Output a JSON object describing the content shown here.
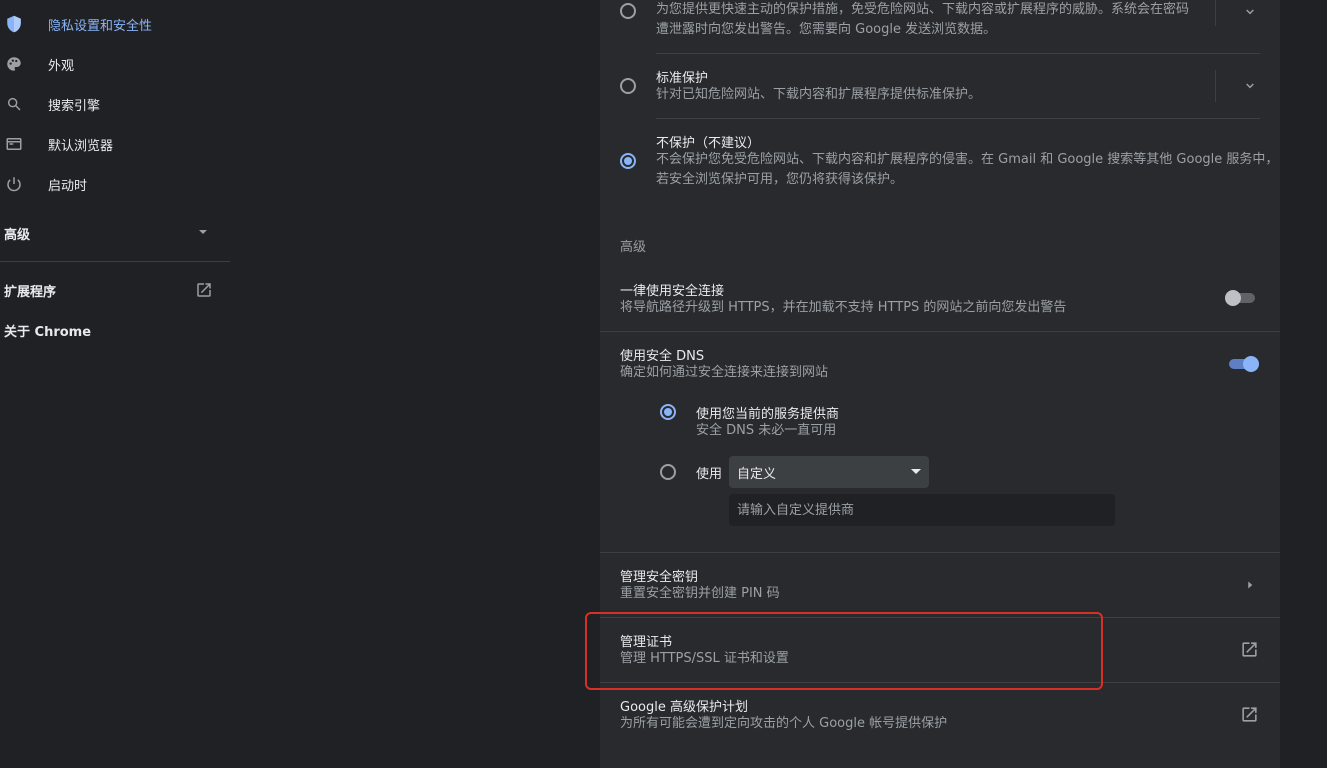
{
  "sidebar": {
    "items": [
      {
        "label": "隐私设置和安全性",
        "icon": "shield-icon",
        "active": true
      },
      {
        "label": "外观",
        "icon": "palette-icon"
      },
      {
        "label": "搜索引擎",
        "icon": "search-icon"
      },
      {
        "label": "默认浏览器",
        "icon": "browser-window-icon"
      },
      {
        "label": "启动时",
        "icon": "power-icon"
      }
    ],
    "advanced_label": "高级",
    "extensions_label": "扩展程序",
    "about_label": "关于 Chrome"
  },
  "safe_browsing": {
    "enhanced_desc_line1": "为您提供更快速主动的保护措施，免受危险网站、下载内容或扩展程序的威胁。系统会在密码",
    "enhanced_desc_line2": "遭泄露时向您发出警告。您需要向 Google 发送浏览数据。",
    "standard_title": "标准保护",
    "standard_desc": "针对已知危险网站、下载内容和扩展程序提供标准保护。",
    "none_title": "不保护（不建议）",
    "none_desc_line1": "不会保护您免受危险网站、下载内容和扩展程序的侵害。在 Gmail 和 Google 搜索等其他 Google 服务中，",
    "none_desc_line2": "若安全浏览保护可用，您仍将获得该保护。",
    "selected": "none"
  },
  "advanced_section": {
    "heading": "高级",
    "https_title": "一律使用安全连接",
    "https_desc": "将导航路径升级到 HTTPS，并在加载不支持 HTTPS 的网站之前向您发出警告",
    "https_enabled": false,
    "dns_title": "使用安全 DNS",
    "dns_desc": "确定如何通过安全连接来连接到网站",
    "dns_enabled": true,
    "dns_current_title": "使用您当前的服务提供商",
    "dns_current_desc": "安全 DNS 未必一直可用",
    "dns_custom_label": "使用",
    "dns_custom_select": "自定义",
    "dns_custom_placeholder": "请输入自定义提供商",
    "dns_selected": "current",
    "keys_title": "管理安全密钥",
    "keys_desc": "重置安全密钥并创建 PIN 码",
    "certs_title": "管理证书",
    "certs_desc": "管理 HTTPS/SSL 证书和设置",
    "app_title": "Google 高级保护计划",
    "app_desc": "为所有可能会遭到定向攻击的个人 Google 帐号提供保护"
  },
  "colors": {
    "background": "#202124",
    "card": "#292a2d",
    "accent": "#8ab4f8",
    "highlight": "#d93025"
  }
}
